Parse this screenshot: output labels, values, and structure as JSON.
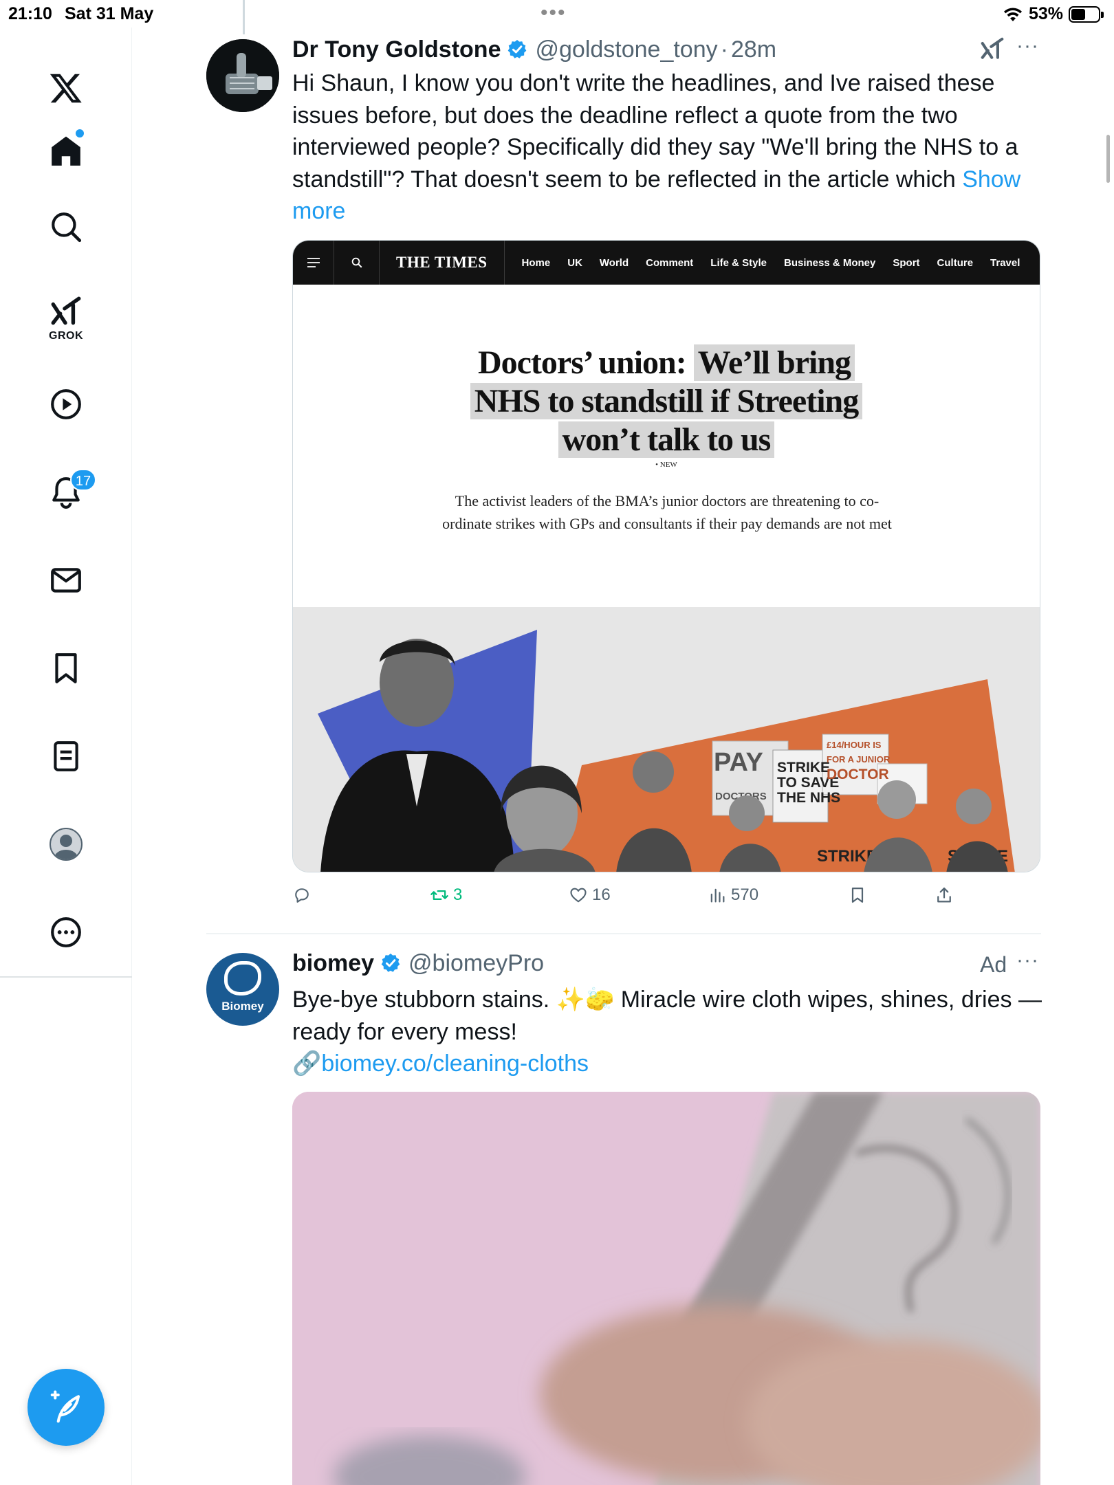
{
  "status_bar": {
    "time": "21:10",
    "date": "Sat 31 May",
    "battery_text": "53%",
    "battery_level": 0.53,
    "multitask_dots": "•••"
  },
  "sidebar": {
    "items": [
      {
        "name": "x-logo",
        "icon": "x-logo-icon"
      },
      {
        "name": "home",
        "icon": "home-icon",
        "has_dot": true
      },
      {
        "name": "explore",
        "icon": "search-icon"
      },
      {
        "name": "grok",
        "icon": "grok-icon",
        "label": "GROK"
      },
      {
        "name": "videos",
        "icon": "play-icon"
      },
      {
        "name": "notifications",
        "icon": "bell-icon",
        "badge": "17"
      },
      {
        "name": "messages",
        "icon": "mail-icon"
      },
      {
        "name": "bookmarks",
        "icon": "bookmark-icon"
      },
      {
        "name": "lists",
        "icon": "list-icon"
      },
      {
        "name": "profile",
        "icon": "avatar-icon"
      },
      {
        "name": "more",
        "icon": "more-circle-icon"
      }
    ],
    "compose_icon": "compose-feather-icon"
  },
  "posts": [
    {
      "name": "Dr Tony Goldstone",
      "handle": "@goldstone_tony",
      "time": "28m",
      "separator": "·",
      "text": "Hi Shaun, I know you don't write the headlines, and Ive raised these issues before, but does the deadline reflect a quote from the two interviewed people? Specifically did they say \"We'll bring the NHS to a standstill\"? That doesn't seem to be reflected in the article which ",
      "show_more": "Show more",
      "card": {
        "logo": "THE TIMES",
        "nav_links": [
          "Home",
          "UK",
          "World",
          "Comment",
          "Life & Style",
          "Business & Money",
          "Sport",
          "Culture",
          "Travel"
        ],
        "headline_plain": "Doctors’ union: ",
        "headline_highlight_1": "We’ll bring",
        "headline_highlight_2": "NHS to standstill if Streeting",
        "headline_highlight_3": "won’t talk to us",
        "tag": "• NEW",
        "standfirst": "The activist leaders of the BMA’s junior doctors are threatening to co-ordinate strikes with GPs and consultants if their pay demands are not met",
        "placards": [
          "PAY",
          "DOCTORS",
          "STRIKE",
          "TO SAVE",
          "THE NHS",
          "£14/HOUR IS",
          "FOR A JUNIOR",
          "DOCTOR",
          "STRIKE",
          "STRIKE"
        ]
      },
      "stats": {
        "replies": "",
        "reposts": "3",
        "likes": "16",
        "views": "570"
      }
    },
    {
      "name": "biomey",
      "handle": "@biomeyPro",
      "ad_label": "Ad",
      "avatar_text": "Biomey",
      "text": "Bye-bye stubborn stains. ✨🧽 Miracle wire cloth wipes, shines, dries —ready for every mess!",
      "link_emoji": "🔗",
      "link": "biomey.co/cleaning-cloths"
    }
  ],
  "colors": {
    "accent": "#1d9bf0",
    "repost_green": "#00ba7c",
    "secondary_text": "#536471"
  }
}
